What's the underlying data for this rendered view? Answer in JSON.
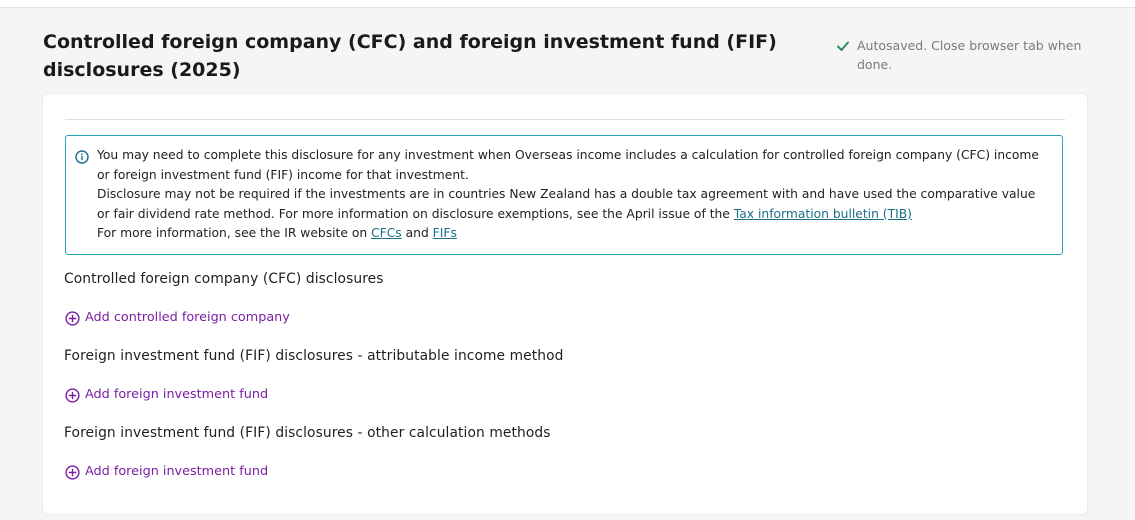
{
  "page": {
    "title": "Controlled foreign company (CFC) and foreign investment fund (FIF) disclosures (2025)",
    "autosave_text": "Autosaved. Close browser tab when done."
  },
  "info": {
    "line1": "You may need to complete this disclosure for any investment when Overseas income includes a calculation for controlled foreign company (CFC) income or foreign investment fund (FIF) income for that investment.",
    "line2_prefix": "Disclosure may not be required if the investments are in countries New Zealand has a double tax agreement with and have used the comparative value or fair dividend rate method. For more information on disclosure exemptions, see the April issue of the ",
    "tib_link": "Tax information bulletin (TIB)",
    "line3_prefix": "For more information, see the IR website on ",
    "cfcs_link": "CFCs",
    "and_text": " and ",
    "fifs_link": "FIFs"
  },
  "sections": {
    "cfc": {
      "heading": "Controlled foreign company (CFC) disclosures",
      "add_label": "Add controlled foreign company"
    },
    "fif_attributable": {
      "heading": "Foreign investment fund (FIF) disclosures - attributable income method",
      "add_label": "Add foreign investment fund"
    },
    "fif_other": {
      "heading": "Foreign investment fund (FIF) disclosures - other calculation methods",
      "add_label": "Add foreign investment fund"
    }
  },
  "colors": {
    "accent_purple": "#7a1fa2",
    "info_border": "#27a5b5",
    "link_teal": "#1a6f87",
    "success_green": "#2e8b57"
  },
  "icons": {
    "autosave": "check-icon",
    "info": "info-circle-icon",
    "add": "plus-circle-icon"
  }
}
